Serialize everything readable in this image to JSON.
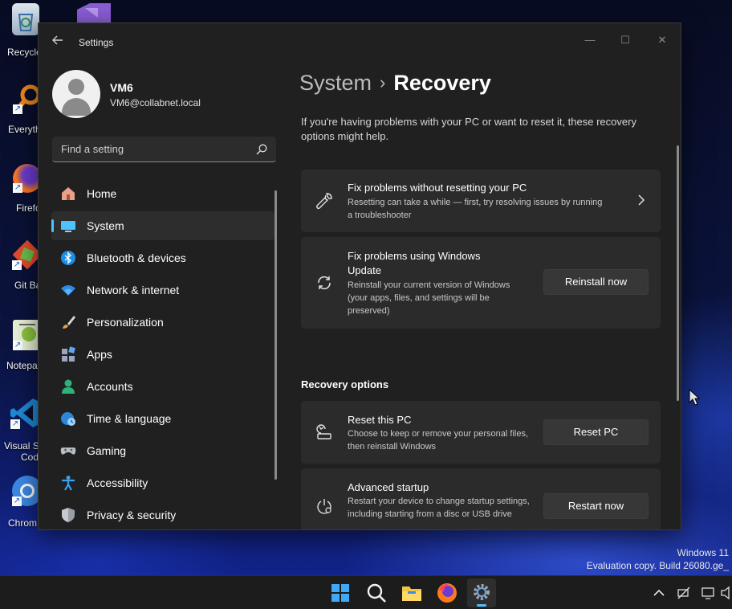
{
  "desktop": {
    "icons": [
      {
        "label": "Recycle",
        "icon": "recycle-bin-icon"
      },
      {
        "label": "Everyth",
        "icon": "everything-search-icon"
      },
      {
        "label": "Firefo",
        "icon": "firefox-icon"
      },
      {
        "label": "Git Ba",
        "icon": "git-bash-icon"
      },
      {
        "label": "Notepa",
        "icon": "notepad-plus-plus-icon"
      },
      {
        "label": "Visual St",
        "label2": "Cod",
        "icon": "vscode-icon"
      },
      {
        "label": "Chrom",
        "icon": "chrome-icon"
      }
    ],
    "watermark_line1": "Windows 11",
    "watermark_line2": "Evaluation copy. Build 26080.ge_"
  },
  "window": {
    "title": "Settings",
    "minimize": "—",
    "maximize": "☐",
    "close": "✕"
  },
  "user": {
    "name": "VM6",
    "email": "VM6@collabnet.local"
  },
  "search": {
    "placeholder": "Find a setting"
  },
  "sidebar": {
    "items": [
      {
        "label": "Home",
        "icon": "home-icon"
      },
      {
        "label": "System",
        "icon": "system-monitor-icon",
        "selected": true
      },
      {
        "label": "Bluetooth & devices",
        "icon": "bluetooth-icon"
      },
      {
        "label": "Network & internet",
        "icon": "wifi-icon"
      },
      {
        "label": "Personalization",
        "icon": "paintbrush-icon"
      },
      {
        "label": "Apps",
        "icon": "apps-icon"
      },
      {
        "label": "Accounts",
        "icon": "accounts-icon"
      },
      {
        "label": "Time & language",
        "icon": "globe-clock-icon"
      },
      {
        "label": "Gaming",
        "icon": "gamepad-icon"
      },
      {
        "label": "Accessibility",
        "icon": "accessibility-icon"
      },
      {
        "label": "Privacy & security",
        "icon": "shield-icon"
      }
    ]
  },
  "main": {
    "breadcrumb_parent": "System",
    "breadcrumb_separator": "›",
    "breadcrumb_current": "Recovery",
    "intro": "If you're having problems with your PC or want to reset it, these recovery options might help.",
    "cards": [
      {
        "title": "Fix problems without resetting your PC",
        "description": "Resetting can take a while — first, try resolving issues by running a troubleshooter",
        "icon": "wrench-icon"
      },
      {
        "title": "Fix problems using Windows Update",
        "description": "Reinstall your current version of Windows (your apps, files, and settings will be preserved)",
        "button": "Reinstall now",
        "icon": "refresh-icon"
      }
    ],
    "section_heading": "Recovery options",
    "recovery_options": [
      {
        "title": "Reset this PC",
        "description": "Choose to keep or remove your personal files, then reinstall Windows",
        "button": "Reset PC",
        "icon": "reset-pc-icon"
      },
      {
        "title": "Advanced startup",
        "description": "Restart your device to change startup settings, including starting from a disc or USB drive",
        "button": "Restart now",
        "icon": "advanced-startup-icon"
      }
    ]
  },
  "taskbar": {
    "apps": [
      "start-icon",
      "search-icon",
      "file-explorer-icon",
      "firefox-icon",
      "settings-icon"
    ],
    "tray": [
      "chevron-up-icon",
      "network-off-icon",
      "display-icon",
      "volume-icon"
    ]
  },
  "colors": {
    "accent": "#4cc2ff",
    "window_bg": "#202020",
    "card_bg": "#2b2b2b",
    "button_bg": "#373737"
  }
}
